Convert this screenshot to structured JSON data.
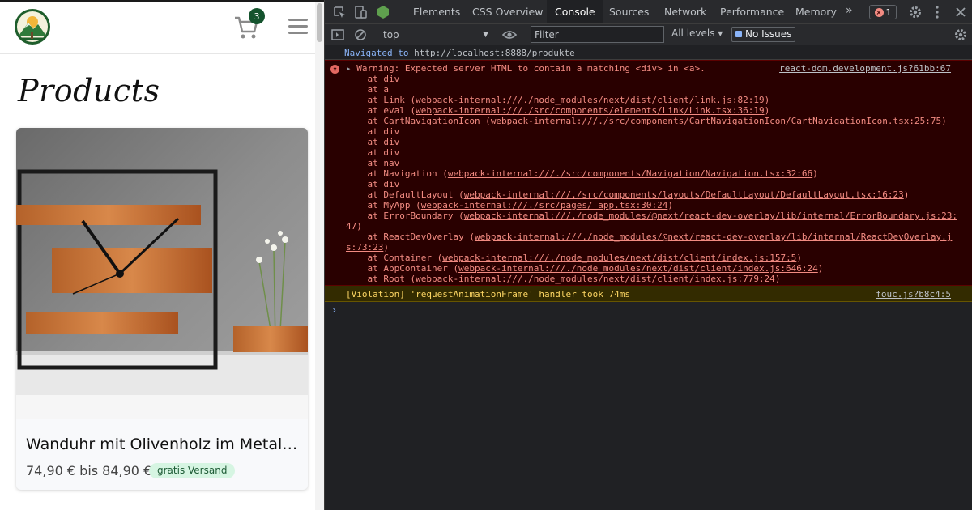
{
  "site": {
    "cart_count": "3",
    "page_title": "Products",
    "product": {
      "title": "Wanduhr mit Olivenholz im Metallrah...",
      "price": "74,90 € bis 84,90 €",
      "badge": "gratis Versand"
    },
    "brand_green": "#14532d"
  },
  "devtools": {
    "tabs": [
      "Elements",
      "CSS Overview",
      "Console",
      "Sources",
      "Network",
      "Performance",
      "Memory"
    ],
    "active_tab": "Console",
    "overflow_label": "»",
    "error_count": "1",
    "context": "top",
    "filter_placeholder": "Filter",
    "levels_label": "All levels ▾",
    "issues_label": "No Issues",
    "navigated_label": "Navigated to",
    "navigated_url": "http://localhost:8888/produkte",
    "error_message": "Warning: Expected server HTML to contain a matching <div> in <a>.",
    "error_source": "react-dom.development.js?61bb:67",
    "stack": [
      {
        "text": "    at div",
        "link": ""
      },
      {
        "text": "    at a",
        "link": ""
      },
      {
        "text": "    at Link (",
        "link": "webpack-internal:///./node_modules/next/dist/client/link.js:82:19",
        "after": ")"
      },
      {
        "text": "    at eval (",
        "link": "webpack-internal:///./src/components/elements/Link/Link.tsx:36:19",
        "after": ")"
      },
      {
        "text": "    at CartNavigationIcon (",
        "link": "webpack-internal:///./src/components/CartNavigationIcon/CartNavigationIcon.tsx:25:75",
        "after": ")"
      },
      {
        "text": "    at div",
        "link": ""
      },
      {
        "text": "    at div",
        "link": ""
      },
      {
        "text": "    at div",
        "link": ""
      },
      {
        "text": "    at nav",
        "link": ""
      },
      {
        "text": "    at Navigation (",
        "link": "webpack-internal:///./src/components/Navigation/Navigation.tsx:32:66",
        "after": ")"
      },
      {
        "text": "    at div",
        "link": ""
      },
      {
        "text": "    at DefaultLayout (",
        "link": "webpack-internal:///./src/components/layouts/DefaultLayout/DefaultLayout.tsx:16:23",
        "after": ")"
      },
      {
        "text": "    at MyApp (",
        "link": "webpack-internal:///./src/pages/_app.tsx:30:24",
        "after": ")"
      },
      {
        "text": "    at ErrorBoundary (",
        "link": "webpack-internal:///./node_modules/@next/react-dev-overlay/lib/internal/ErrorBoundary.js:23:",
        "after": ""
      },
      {
        "text": "47)",
        "link": "",
        "indent0": true
      },
      {
        "text": "    at ReactDevOverlay (",
        "link": "webpack-internal:///./node_modules/@next/react-dev-overlay/lib/internal/ReactDevOverlay.j",
        "after": ""
      },
      {
        "text": "",
        "link": "s:73:23",
        "after": ")",
        "indent0": true
      },
      {
        "text": "    at Container (",
        "link": "webpack-internal:///./node_modules/next/dist/client/index.js:157:5",
        "after": ")"
      },
      {
        "text": "    at AppContainer (",
        "link": "webpack-internal:///./node_modules/next/dist/client/index.js:646:24",
        "after": ")"
      },
      {
        "text": "    at Root (",
        "link": "webpack-internal:///./node_modules/next/dist/client/index.js:779:24",
        "after": ")"
      }
    ],
    "violation_message": "[Violation] 'requestAnimationFrame' handler took 74ms",
    "violation_source": "fouc.js?b8c4:5",
    "prompt_glyph": "›"
  }
}
